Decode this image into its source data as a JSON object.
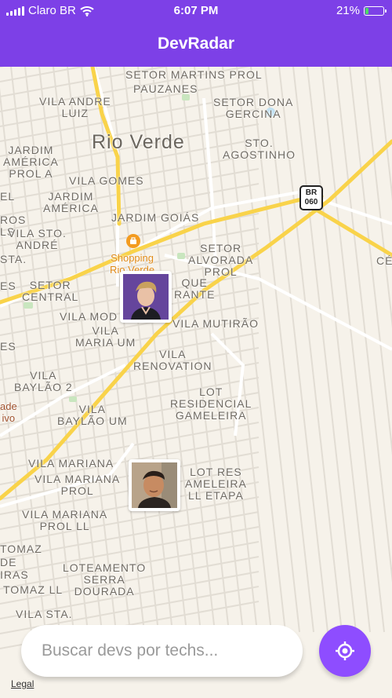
{
  "status_bar": {
    "carrier": "Claro BR",
    "time": "6:07 PM",
    "battery": "21%",
    "battery_level": 0.21,
    "icons": [
      "signal-bars-icon",
      "wifi-icon",
      "battery-icon"
    ]
  },
  "header": {
    "title": "DevRadar"
  },
  "map": {
    "labels": [
      "SETOR MARTINS PROL",
      "PAUZANES",
      "VILA ANDRE\nLUIZ",
      "SETOR DONA\nGERCINA",
      "Rio Verde",
      "JARDIM\nAMÉRICA\nPROL A",
      "STO.\nAGOSTINHO",
      "VILA GOMES",
      "EL",
      "JARDIM\nAMÉRICA",
      "ROS",
      "LS",
      "VILA STO.\nANDRÉ",
      "JARDIM GOIÁS",
      "STA.",
      "ES",
      "SETOR\nCENTRAL",
      "SETOR\nALVORADA\nPROL",
      "QUE\nRANTE",
      "VILA MOD",
      "VILA\nMARIA UM",
      "VILA MUTIRÃO",
      "ES",
      "VILA\nRENOVATION",
      "VILA\nBAYLÃO 2",
      "LOT\nRESIDENCIAL\nGAMELEIRA",
      "VILA\nBAYLÃO UM",
      "VILA MARIANA",
      "VILA MARIANA\nPROL",
      "LOT RES\nAMELEIRA\nLL ETAPA",
      "VILA MARIANA\nPROL LL",
      "TOMAZ",
      "DE",
      "LOTEAMENTO\nSERRA\nDOURADA",
      "IRAS",
      "TOMAZ LL",
      "VILA STA.",
      "CÉ"
    ],
    "poi": {
      "name": "Shopping\nRio Verde",
      "icon": "shopping-bag-icon"
    },
    "partial_poi": "ade\nivo",
    "highway_shield": "BR\n060",
    "markers": [
      {
        "name": "dev-marker-1",
        "icon": "avatar-photo"
      },
      {
        "name": "dev-marker-2",
        "icon": "avatar-photo"
      }
    ],
    "legal": "Legal"
  },
  "search": {
    "placeholder": "Buscar devs por techs...",
    "value": ""
  },
  "locate_button": {
    "icon": "gps-crosshair-icon"
  },
  "colors": {
    "accent": "#7d40e7",
    "button": "#8e4dff",
    "road_major": "#f9d34a",
    "map_bg": "#f6f2ea"
  }
}
